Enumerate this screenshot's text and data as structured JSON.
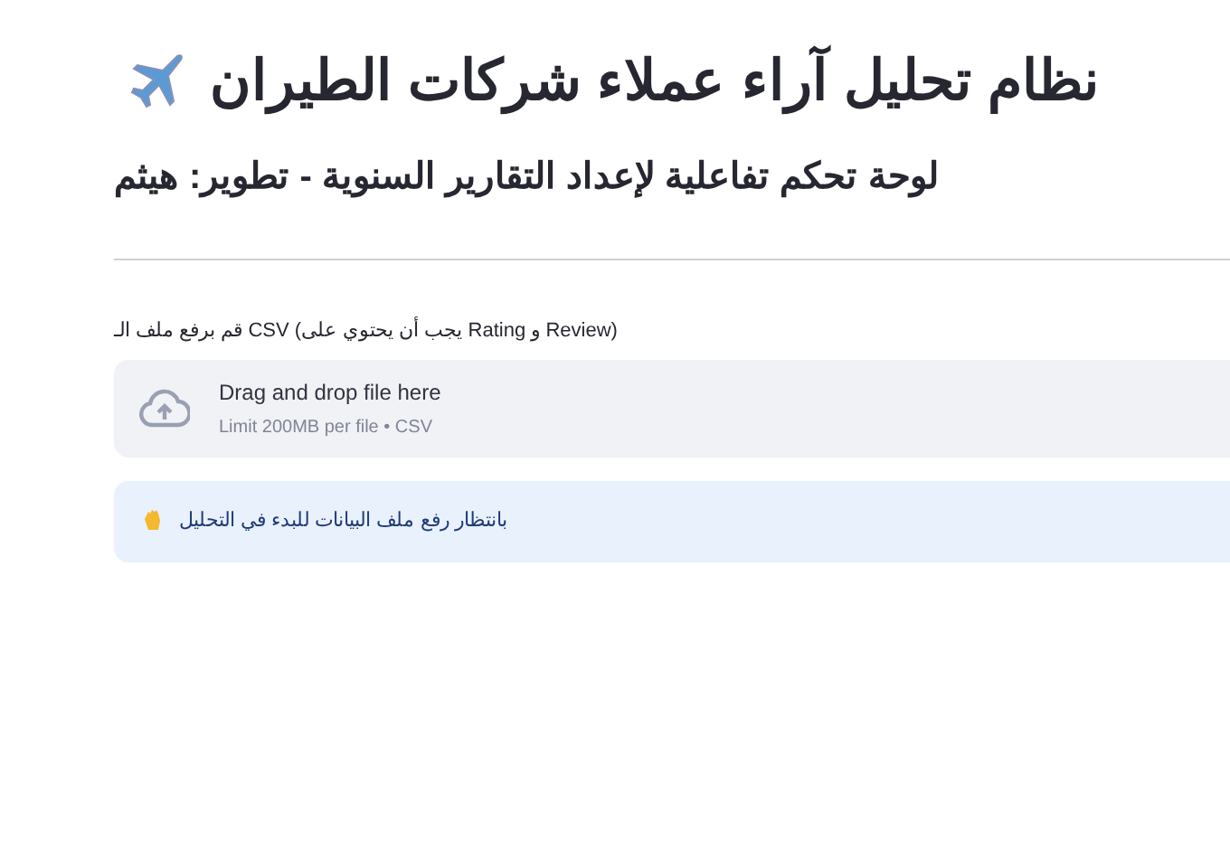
{
  "header": {
    "title": "نظام تحليل آراء عملاء شركات الطيران",
    "subtitle": "لوحة تحكم تفاعلية لإعداد التقارير السنوية - تطوير: هيثم"
  },
  "uploader": {
    "label": "قم برفع ملف الـ CSV (يجب أن يحتوي على Rating و Review)",
    "drop_text": "Drag and drop file here",
    "limit_text": "Limit 200MB per file • CSV"
  },
  "info": {
    "text": "بانتظار رفع ملف البيانات للبدء في التحليل"
  }
}
